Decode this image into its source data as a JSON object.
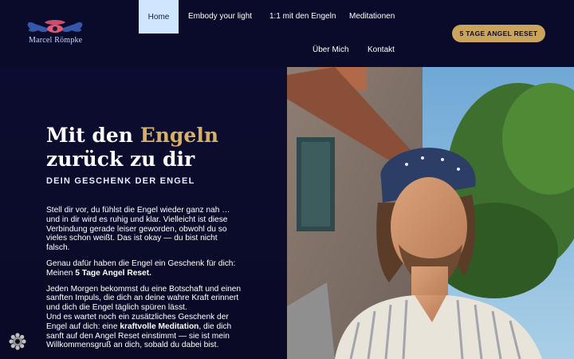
{
  "brand": {
    "name": "Marcel Römpke"
  },
  "nav": {
    "items": [
      {
        "label": "Home"
      },
      {
        "label": "Embody your light"
      },
      {
        "label": "1:1 mit den Engeln"
      },
      {
        "label": "Meditationen"
      },
      {
        "label": "Über Mich"
      },
      {
        "label": "Kontakt"
      }
    ],
    "cta_label": "5 TAGE ANGEL RESET"
  },
  "hero": {
    "headline_part1": "Mit den ",
    "headline_highlight": "Engeln",
    "headline_part2": "zurück zu dir",
    "subtitle": "DEIN GESCHENK DER ENGEL",
    "p1": "Stell dir vor, du fühlst die Engel wieder ganz nah … und in dir wird es ruhig und klar. Vielleicht ist diese Verbindung gerade leiser geworden, obwohl du so vieles schon weißt. Das ist okay — du bist nicht falsch.",
    "p2_before": "Genau dafür haben die Engel ein Geschenk für dich: Meinen ",
    "p2_bold": "5 Tage Angel Reset.",
    "p3": "Jeden Morgen bekommst du eine Botschaft und einen sanften Impuls, die dich an deine wahre Kraft erinnert und dich die Engel täglich spüren lässt.",
    "p4_before": "Und es wartet noch ein zusätzliches Geschenk der Engel auf dich: eine ",
    "p4_bold": "kraftvolle Meditation",
    "p4_after": ", die dich sanft auf den Angel Reset einstimmt — sie ist mein Willkommensgruß an dich, sobald du dabei bist."
  },
  "colors": {
    "background": "#0b0b2a",
    "accent_gold": "#c9a45a",
    "nav_active_bg": "#cfe6ff"
  },
  "icons": {
    "logo": "angel-wings-eye-logo",
    "settings": "settings-gear-icon"
  }
}
